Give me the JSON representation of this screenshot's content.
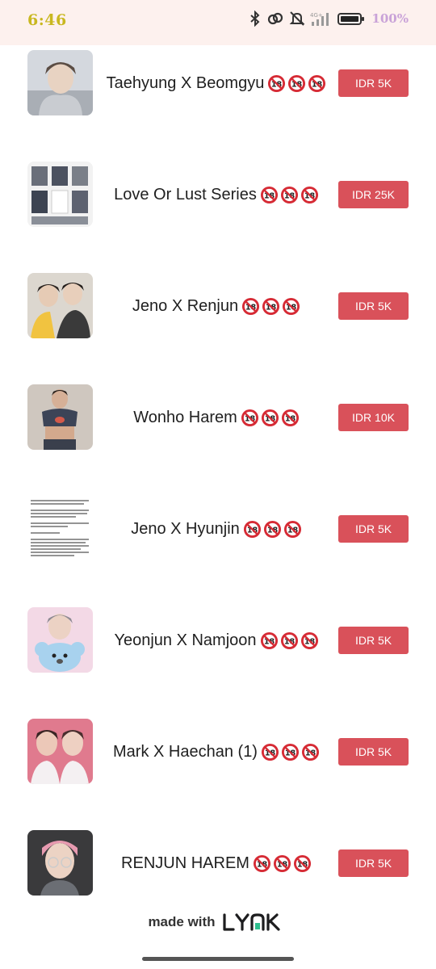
{
  "status_bar": {
    "time": "6:46",
    "battery_percent": "100%",
    "icons": [
      "bluetooth-icon",
      "link-icon",
      "mute-icon",
      "signal-icon",
      "battery-icon"
    ]
  },
  "products": [
    {
      "title": "Taehyung X Beomgyu",
      "price": "IDR 5K",
      "badge": "18",
      "badge_count": 3,
      "thumb": "photo-person-gray-hoodie"
    },
    {
      "title": "Love Or Lust Series",
      "price": "IDR 25K",
      "badge": "18",
      "badge_count": 3,
      "thumb": "photo-collage-love-or-lust"
    },
    {
      "title": "Jeno X Renjun",
      "price": "IDR 5K",
      "badge": "18",
      "badge_count": 3,
      "thumb": "photo-two-people"
    },
    {
      "title": "Wonho Harem",
      "price": "IDR 10K",
      "badge": "18",
      "badge_count": 3,
      "thumb": "photo-person-crop-top"
    },
    {
      "title": "Jeno X Hyunjin",
      "price": "IDR 5K",
      "badge": "18",
      "badge_count": 3,
      "thumb": "photo-text-document"
    },
    {
      "title": "Yeonjun X Namjoon",
      "price": "IDR 5K",
      "badge": "18",
      "badge_count": 3,
      "thumb": "photo-person-with-koala-plush"
    },
    {
      "title": "Mark X Haechan (1)",
      "price": "IDR 5K",
      "badge": "18",
      "badge_count": 3,
      "thumb": "photo-two-people-pink"
    },
    {
      "title": "RENJUN HAREM",
      "price": "IDR 5K",
      "badge": "18",
      "badge_count": 3,
      "thumb": "photo-person-pink-hair-glasses"
    }
  ],
  "footer": {
    "made_with": "made with",
    "logo_text": "LYNK"
  },
  "colors": {
    "price_button": "#d9515a",
    "status_bar_bg": "#fdf1ee",
    "badge_red": "#d62b35"
  }
}
